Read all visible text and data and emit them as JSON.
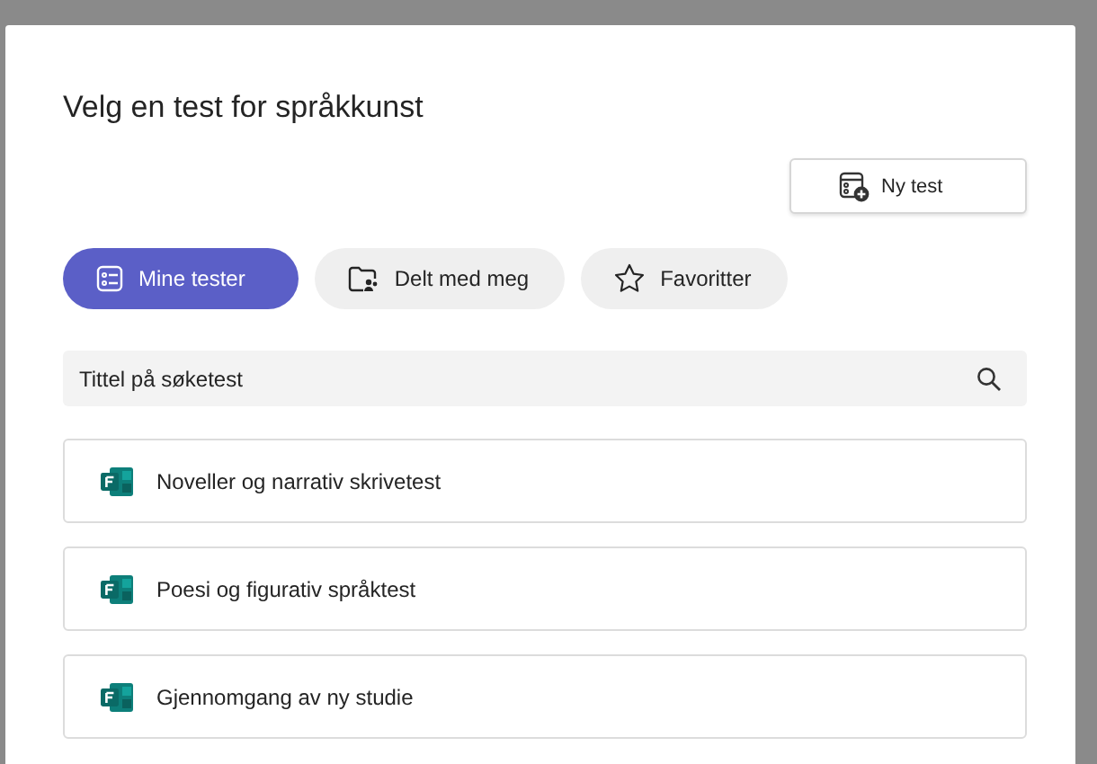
{
  "dialog": {
    "title": "Velg en test for språkkunst"
  },
  "new_button": {
    "label": "Ny test"
  },
  "tabs": [
    {
      "label": "Mine tester",
      "kind": "list",
      "selected": true
    },
    {
      "label": "Delt med meg",
      "kind": "shared-folder",
      "selected": false
    },
    {
      "label": "Favoritter",
      "kind": "star",
      "selected": false
    }
  ],
  "search": {
    "placeholder": "Tittel på søketest"
  },
  "tests": [
    {
      "title": "Noveller og narrativ skrivetest"
    },
    {
      "title": "Poesi og figurativ språktest"
    },
    {
      "title": "Gjennomgang av ny studie"
    }
  ]
}
